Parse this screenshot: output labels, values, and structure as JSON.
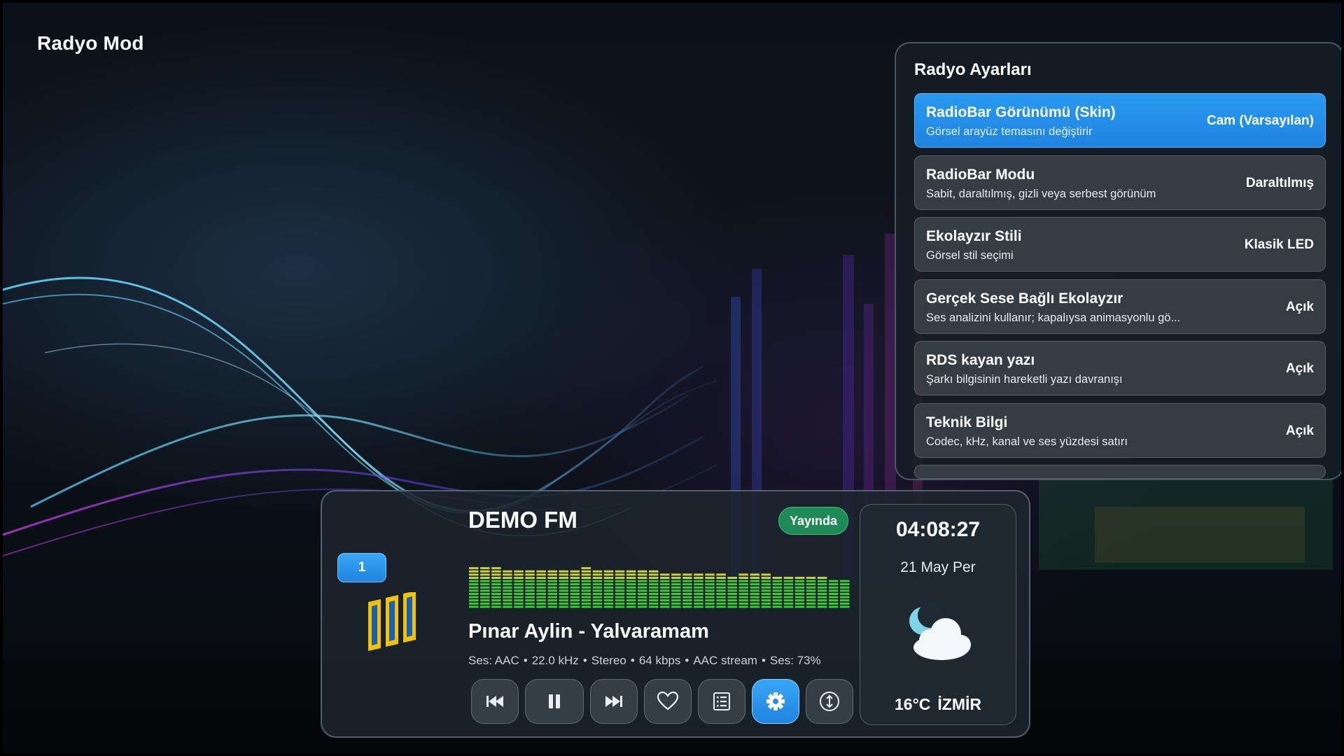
{
  "page": {
    "title": "Radyo Mod"
  },
  "settings": {
    "title": "Radyo Ayarları",
    "items": [
      {
        "name": "RadioBar Görünümü (Skin)",
        "desc": "Görsel arayüz temasını değiştirir",
        "value": "Cam (Varsayılan)",
        "active": true
      },
      {
        "name": "RadioBar Modu",
        "desc": "Sabit, daraltılmış, gizli veya serbest görünüm",
        "value": "Daraltılmış",
        "active": false
      },
      {
        "name": "Ekolayzır Stili",
        "desc": "Görsel stil seçimi",
        "value": "Klasik LED",
        "active": false
      },
      {
        "name": "Gerçek Sese Bağlı Ekolayzır",
        "desc": "Ses analizini kullanır; kapalıysa animasyonlu gö...",
        "value": "Açık",
        "active": false
      },
      {
        "name": "RDS kayan yazı",
        "desc": "Şarkı bilgisinin hareketli yazı davranışı",
        "value": "Açık",
        "active": false
      },
      {
        "name": "Teknik Bilgi",
        "desc": "Codec, kHz, kanal ve ses yüzdesi satırı",
        "value": "Açık",
        "active": false
      }
    ]
  },
  "player": {
    "channel_number": "1",
    "station": "DEMO FM",
    "live_label": "Yayında",
    "song": "Pınar Aylin - Yalvaramam",
    "tech": [
      "Ses: AAC",
      "22.0 kHz",
      "Stereo",
      "64 kbps",
      "AAC stream",
      "Ses: 73%"
    ],
    "tech_separator": "•",
    "equalizer_levels": [
      0.82,
      0.84,
      0.84,
      0.78,
      0.76,
      0.74,
      0.72,
      0.74,
      0.78,
      0.76,
      0.8,
      0.76,
      0.74,
      0.76,
      0.74,
      0.76,
      0.74,
      0.7,
      0.68,
      0.7,
      0.68,
      0.68,
      0.66,
      0.64,
      0.66,
      0.7,
      0.66,
      0.64,
      0.62,
      0.6,
      0.64,
      0.6,
      0.56,
      0.54
    ],
    "equalizer_colors": {
      "low": "#3ec83a",
      "mid": "#c8d23a",
      "high": "#e53b3b"
    },
    "controls": [
      {
        "name": "previous-button",
        "icon": "skip-previous-icon"
      },
      {
        "name": "pause-button",
        "icon": "pause-icon"
      },
      {
        "name": "next-button",
        "icon": "skip-next-icon"
      },
      {
        "name": "favorite-button",
        "icon": "heart-icon"
      },
      {
        "name": "list-button",
        "icon": "list-icon"
      },
      {
        "name": "settings-button",
        "icon": "gear-icon",
        "active": true
      },
      {
        "name": "position-button",
        "icon": "move-vertical-icon"
      }
    ]
  },
  "weather": {
    "time": "04:08:27",
    "date": "21 May Per",
    "temperature": "16°C",
    "city": "İZMİR",
    "icon": "cloud-moon-icon"
  },
  "colors": {
    "accent": "#2a99f0",
    "live": "#1f8a55",
    "logo_yellow": "#f2c20b",
    "logo_blue": "#1a5fb4"
  }
}
